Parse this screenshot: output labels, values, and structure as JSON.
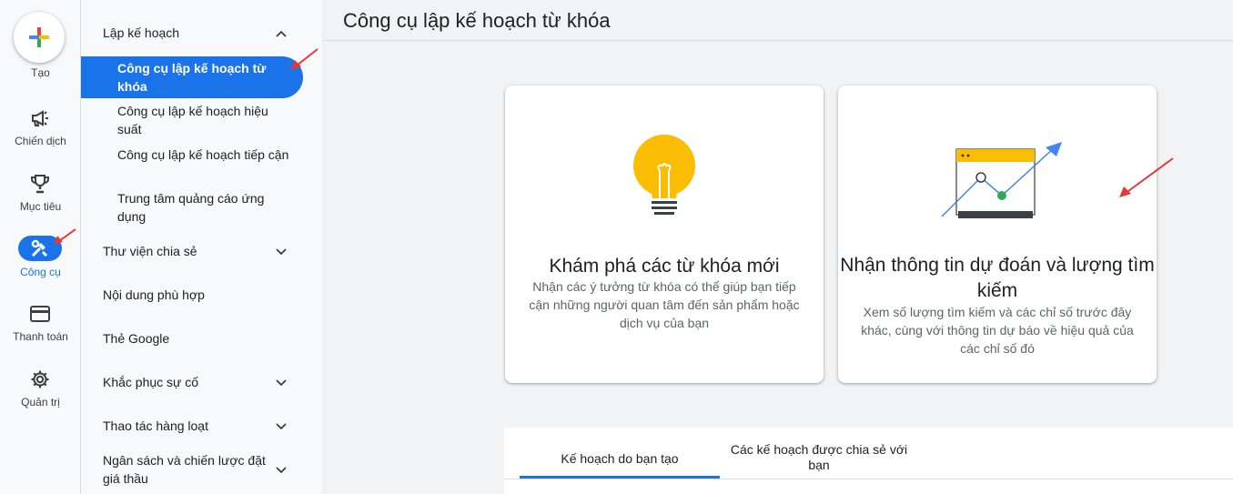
{
  "rail": {
    "create_label": "Tạo",
    "items": [
      {
        "label": "Chiến dịch",
        "icon": "megaphone-icon"
      },
      {
        "label": "Mục tiêu",
        "icon": "trophy-icon"
      },
      {
        "label": "Công cụ",
        "icon": "tools-icon",
        "active": true
      },
      {
        "label": "Thanh toán",
        "icon": "credit-card-icon"
      },
      {
        "label": "Quản trị",
        "icon": "gear-icon"
      }
    ]
  },
  "nav": {
    "planning_header": "Lập kế hoạch",
    "active_item": "Công cụ lập kế hoạch từ khóa",
    "sub_items": [
      "Công cụ lập kế hoạch hiệu suất",
      "Công cụ lập kế hoạch tiếp cận",
      "Trung tâm quảng cáo ứng dụng"
    ],
    "sections": [
      "Thư viện chia sẻ",
      "Nội dung phù hợp",
      "Thẻ Google",
      "Khắc phục sự cố",
      "Thao tác hàng loạt",
      "Ngân sách và chiến lược đặt giá thầu"
    ]
  },
  "main": {
    "title": "Công cụ lập kế hoạch từ khóa",
    "cards": [
      {
        "title": "Khám phá các từ khóa mới",
        "description": "Nhận các ý tưởng từ khóa có thể giúp bạn tiếp cận những người quan tâm đến sản phẩm hoặc dịch vụ của bạn",
        "icon": "lightbulb-icon"
      },
      {
        "title": "Nhận thông tin dự đoán và lượng tìm kiếm",
        "description": "Xem số lượng tìm kiếm và các chỉ số trước đây khác, cùng với thông tin dự báo về hiệu quả của các chỉ số đó",
        "icon": "forecast-chart-icon"
      }
    ],
    "tabs": [
      "Kế hoạch do bạn tạo",
      "Các kế hoạch được chia sẻ với bạn"
    ]
  },
  "colors": {
    "accent": "#1a73e8",
    "annotation_arrow": "#e53935",
    "bulb": "#fbbc04"
  }
}
